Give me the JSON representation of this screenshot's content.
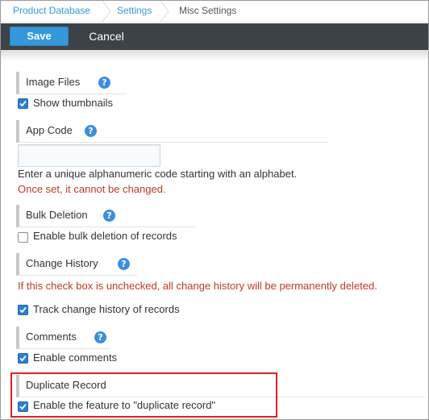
{
  "breadcrumb": {
    "items": [
      "Product Database",
      "Settings",
      "Misc Settings"
    ]
  },
  "toolbar": {
    "save_label": "Save",
    "cancel_label": "Cancel"
  },
  "sections": {
    "image_files": {
      "title": "Image Files",
      "option_label": "Show thumbnails",
      "checked": true
    },
    "app_code": {
      "title": "App Code",
      "input_value": "",
      "hint": "Enter a unique alphanumeric code starting with an alphabet.",
      "warning": "Once set, it cannot be changed."
    },
    "bulk_deletion": {
      "title": "Bulk Deletion",
      "option_label": "Enable bulk deletion of records",
      "checked": false
    },
    "change_history": {
      "title": "Change History",
      "warning": "If this check box is unchecked, all change history will be permanently deleted.",
      "option_label": "Track change history of records",
      "checked": true
    },
    "comments": {
      "title": "Comments",
      "option_label": "Enable comments",
      "checked": true
    },
    "duplicate_record": {
      "title": "Duplicate Record",
      "option_label": "Enable the feature to \"duplicate record\"",
      "checked": true
    }
  },
  "icons": {
    "help": "question-circle-icon",
    "check": "checkmark-icon",
    "separator": "chevron-right-icon"
  },
  "colors": {
    "accent": "#3498db",
    "toolbar_bg": "#3d4246",
    "warning_text": "#c0392b",
    "highlight": "#e02020"
  }
}
